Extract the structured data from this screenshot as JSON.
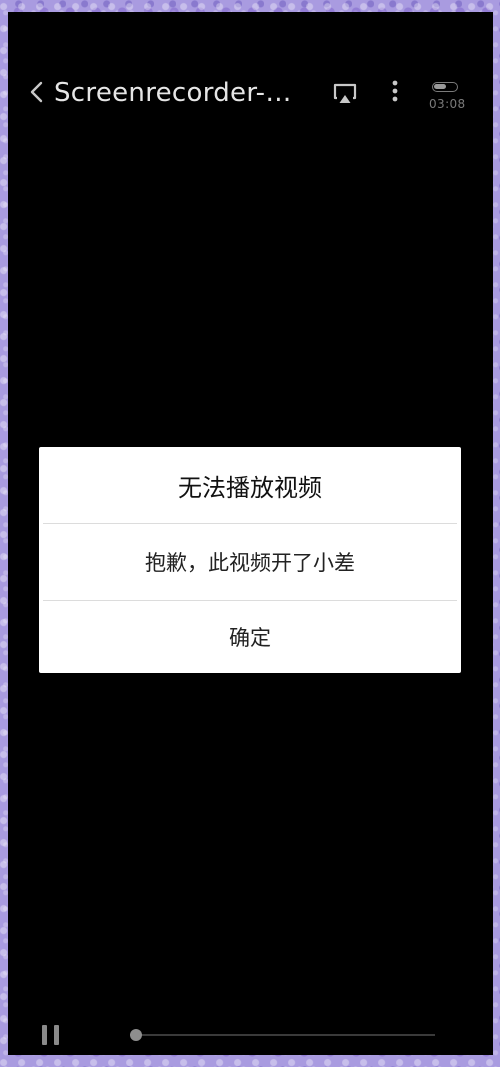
{
  "header": {
    "title": "Screenrecorder-2…",
    "status_time": "03:08",
    "icons": {
      "back": "chevron-left-icon",
      "cast": "screen-cast-icon",
      "more": "more-vertical-icon",
      "battery": "battery-icon"
    }
  },
  "dialog": {
    "title": "无法播放视频",
    "message": "抱歉，此视频开了小差",
    "confirm_label": "确定"
  },
  "player": {
    "progress": 0.0,
    "icons": {
      "pause": "pause-icon"
    }
  },
  "colors": {
    "video_background": "#000000",
    "frame_background": "#a99be0",
    "dialog_background": "#ffffff",
    "icon_gray": "#8a8a8a"
  }
}
